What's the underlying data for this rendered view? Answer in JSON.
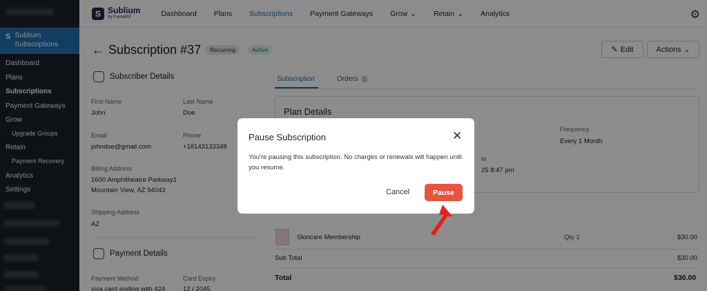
{
  "wp_sidebar": {
    "current_section": "Sublium Subscriptions",
    "menu": [
      "Dashboard",
      "Plans",
      "Subscriptions",
      "Payment Gateways",
      "Grow",
      "Upgrade Groups",
      "Retain",
      "Payment Recovery",
      "Analytics",
      "Settings"
    ]
  },
  "topbar": {
    "brand_name": "Sublium",
    "brand_sub": "by FunnelKit",
    "nav": [
      "Dashboard",
      "Plans",
      "Subscriptions",
      "Payment Gateways",
      "Grow",
      "Retain",
      "Analytics"
    ]
  },
  "page": {
    "title": "Subscription #37",
    "badge_recurring": "Recurring",
    "badge_active": "Active",
    "edit_label": "Edit",
    "actions_label": "Actions"
  },
  "subscriber": {
    "heading": "Subscriber Details",
    "first_name_label": "First Name",
    "first_name": "John",
    "last_name_label": "Last Name",
    "last_name": "Doe",
    "email_label": "Email",
    "email": "johndoe@gmail.com",
    "phone_label": "Phone",
    "phone": "+18143133348",
    "billing_label": "Billing Address",
    "billing_line1": "1600 Amphitheatre Parkway1",
    "billing_line2": "Mountain View, AZ 94043",
    "shipping_label": "Shipping Address",
    "shipping": "AZ"
  },
  "payment": {
    "heading": "Payment Details",
    "method_label": "Payment Method",
    "method": "visa card ending with 424",
    "expiry_label": "Card Expiry",
    "expiry": "12 / 2045"
  },
  "tabs": {
    "subscription": "Subscription",
    "orders": "Orders",
    "orders_count": "1"
  },
  "plan": {
    "heading": "Plan Details",
    "frequency_label": "Frequency",
    "frequency": "Every 1 Month",
    "partial_date_label": "te",
    "partial_date": "25 8:47 pm"
  },
  "items": {
    "product": "Skincare Membership",
    "qty": "Qty 1",
    "price": "$30.00",
    "subtotal_label": "Sub Total",
    "subtotal": "$30.00",
    "total_label": "Total",
    "total": "$30.00"
  },
  "modal": {
    "title": "Pause Subscription",
    "text": "You're pausing this subscription. No charges or renewals will happen until you resume.",
    "cancel": "Cancel",
    "pause": "Pause"
  },
  "colors": {
    "accent": "#2271b1",
    "pause": "#e5543f",
    "arrow": "#e8201a"
  }
}
